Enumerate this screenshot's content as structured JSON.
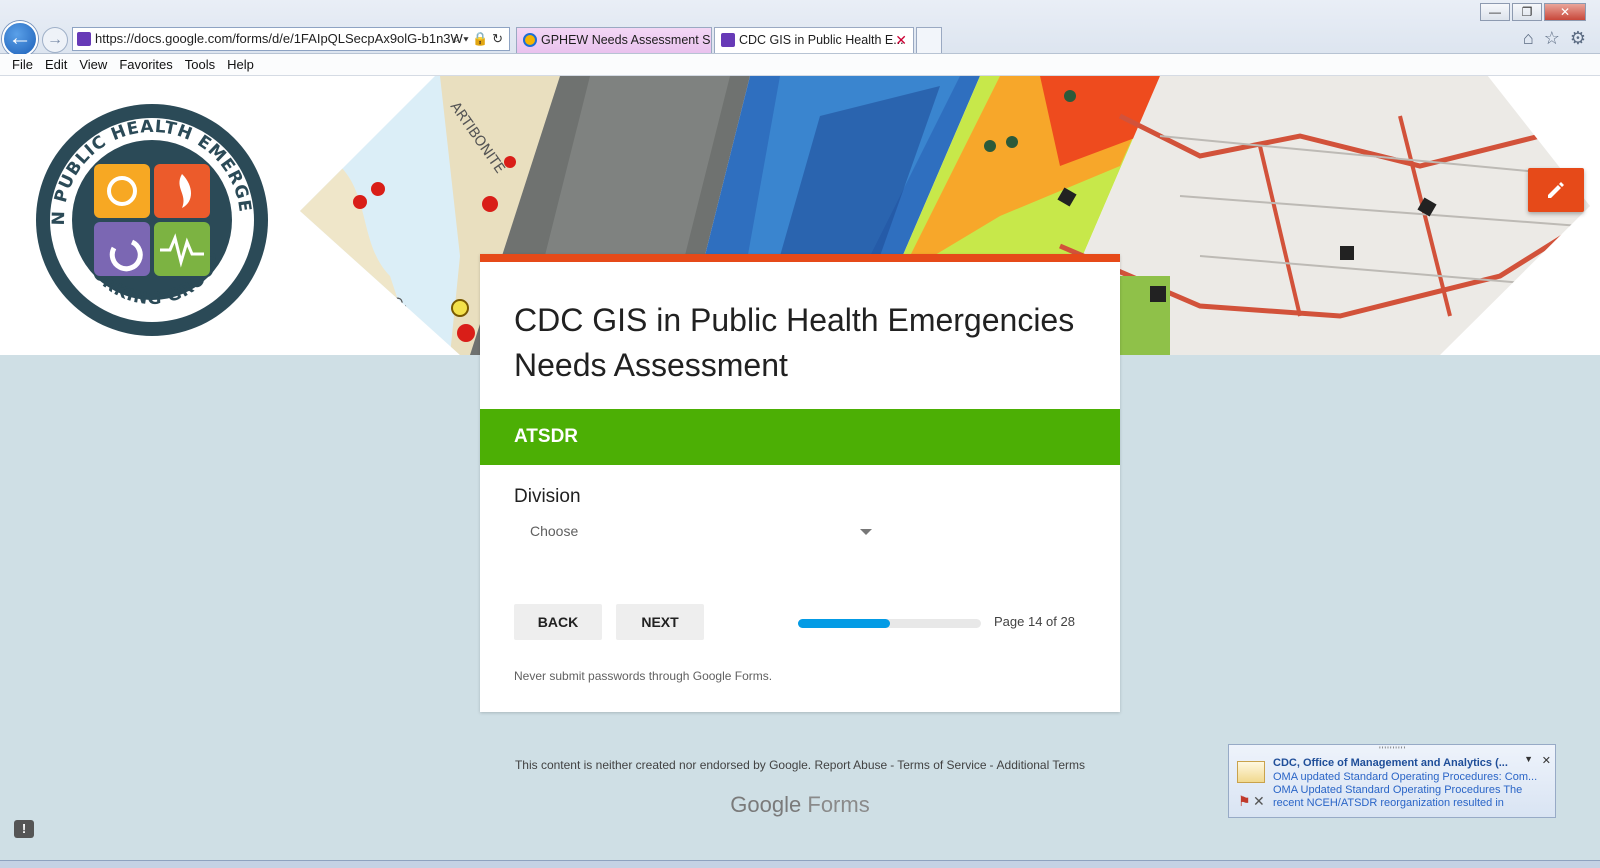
{
  "browser": {
    "url": "https://docs.google.com/forms/d/e/1FAIpQLSecpAx9olG-b1n3W",
    "tabs": [
      {
        "label": "GPHEW Needs Assessment Su..."
      },
      {
        "label": "CDC GIS in Public Health E..."
      }
    ],
    "menu": [
      "File",
      "Edit",
      "View",
      "Favorites",
      "Tools",
      "Help"
    ],
    "window_buttons": {
      "minimize": "—",
      "restore": "❐",
      "close": "✕"
    }
  },
  "logo": {
    "ring_top": "GIS IN PUBLIC HEALTH EMERGENCIES",
    "ring_bottom": "WORKING GROUP"
  },
  "form": {
    "title": "CDC GIS in Public Health Emergencies Needs Assessment",
    "section_title": "ATSDR",
    "question_label": "Division",
    "dropdown_value": "Choose",
    "back_label": "BACK",
    "next_label": "NEXT",
    "progress_fraction": 0.5,
    "page_indicator": "Page 14 of 28",
    "password_warning": "Never submit passwords through Google Forms."
  },
  "footer": {
    "disclaimer": "This content is neither created nor endorsed by Google.",
    "report_abuse": "Report Abuse",
    "terms": "Terms of Service",
    "additional_terms": "Additional Terms",
    "brand_google": "Google",
    "brand_forms": "Forms"
  },
  "notification": {
    "title": "CDC, Office of Management and Analytics (...",
    "line1": "OMA updated Standard Operating Procedures: Com...",
    "line2": "OMA Updated Standard Operating Procedures  The",
    "line3": "recent NCEH/ATSDR reorganization resulted in"
  },
  "colors": {
    "accent_orange": "#e64a19",
    "section_green": "#4caf05",
    "progress_blue": "#039be5",
    "page_bg": "#cfdfe5"
  }
}
